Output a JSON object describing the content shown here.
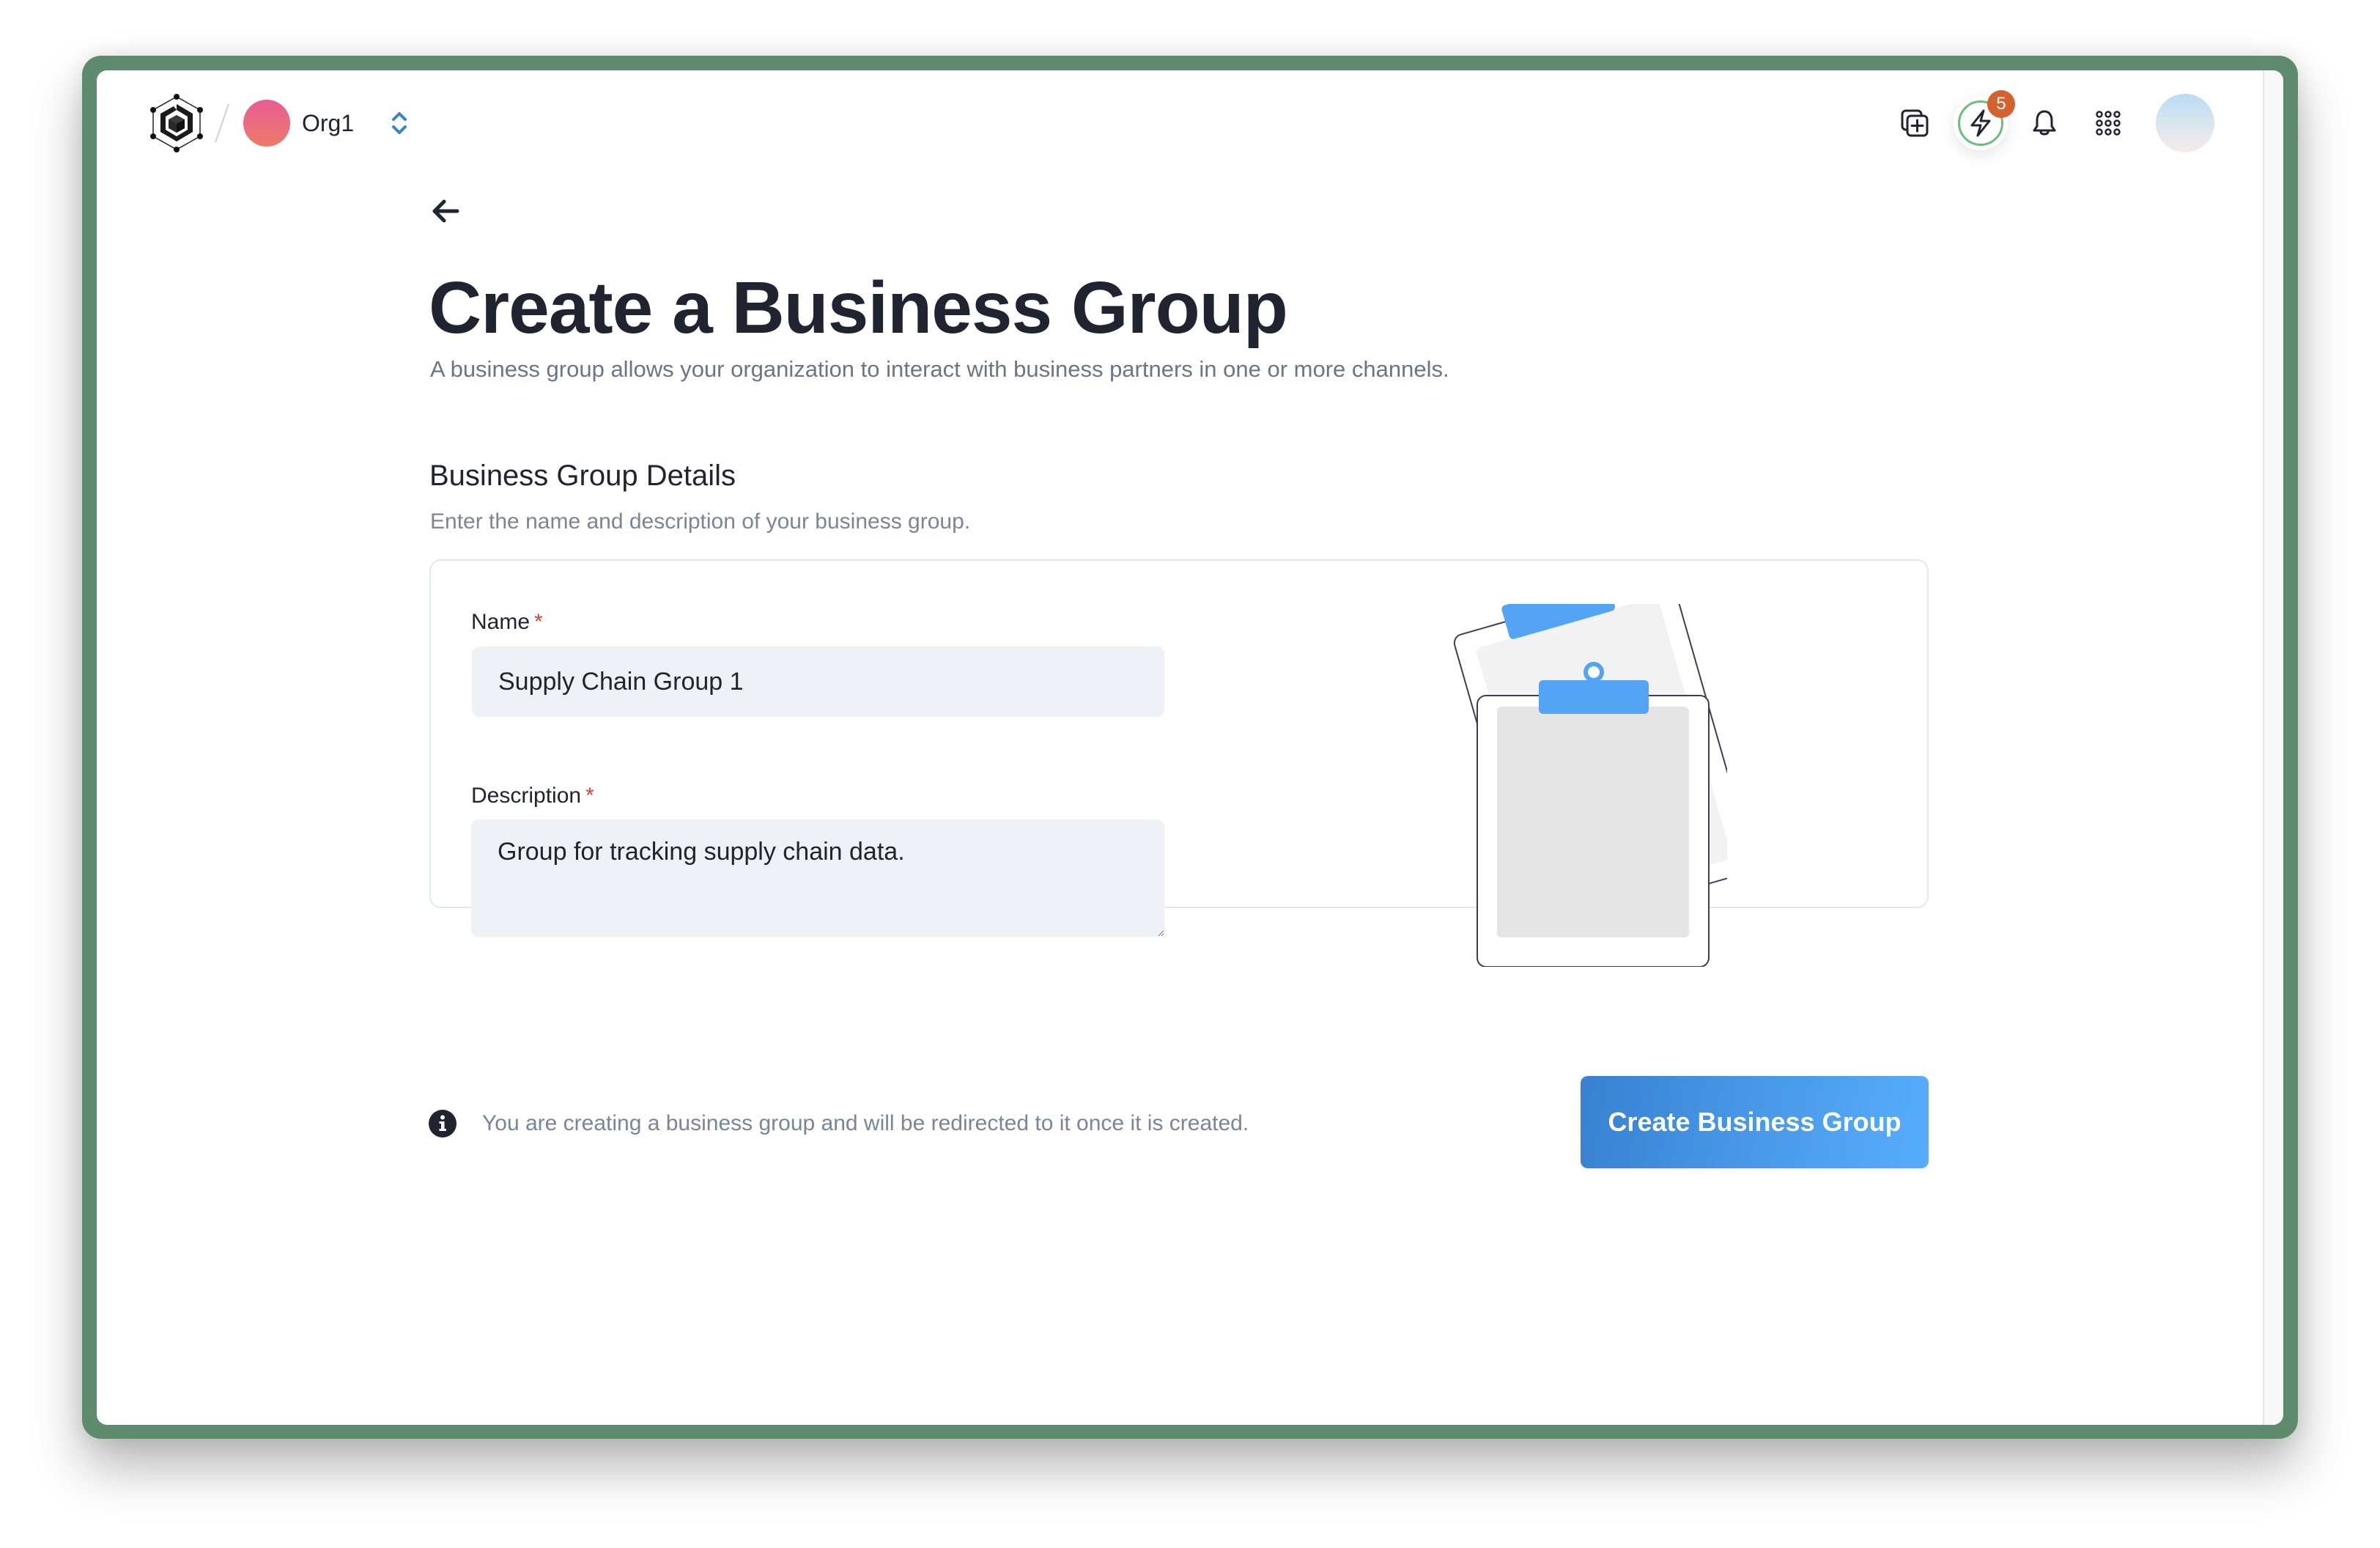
{
  "header": {
    "logo": "hexagon-cube-logo-icon",
    "org": {
      "name": "Org1",
      "avatar_gradient": [
        "#E85E96",
        "#EC7A66"
      ],
      "switch_icon": "chevron-up-down-icon"
    },
    "actions": [
      {
        "name": "create-duplicate",
        "icon": "duplicate-plus-icon"
      },
      {
        "name": "quick-actions",
        "icon": "lightning-bolt-icon",
        "badge": "5",
        "ring_color": "#6BBF7B",
        "badge_color": "#D4622F"
      },
      {
        "name": "notifications",
        "icon": "bell-icon"
      },
      {
        "name": "apps",
        "icon": "grid-dots-icon"
      },
      {
        "name": "user-profile",
        "icon": "user-avatar"
      }
    ]
  },
  "page": {
    "back_icon": "arrow-left-icon",
    "title": "Create a Business Group",
    "subtitle": "A business group allows your organization to interact with business partners in one or more channels."
  },
  "section": {
    "title": "Business Group Details",
    "description": "Enter the name and description of your business group."
  },
  "form": {
    "name": {
      "label": "Name",
      "required_mark": "*",
      "value": "Supply Chain Group 1"
    },
    "description": {
      "label": "Description",
      "required_mark": "*",
      "value": "Group for tracking supply chain data."
    },
    "illustration": "clipboards-illustration"
  },
  "footer": {
    "info_icon": "info-circle-icon",
    "info_text": "You are creating a business group and will be redirected to it once it is created.",
    "submit_label": "Create Business Group"
  },
  "colors": {
    "frame": "#5E8A6E",
    "accent": "#3B8DE0",
    "accent_light": "#57ADFC",
    "required": "#D9413A",
    "text_primary": "#1F2430",
    "text_muted": "#6B7585",
    "input_bg": "#EEF1F5",
    "clip_blue": "#54A4F5"
  }
}
